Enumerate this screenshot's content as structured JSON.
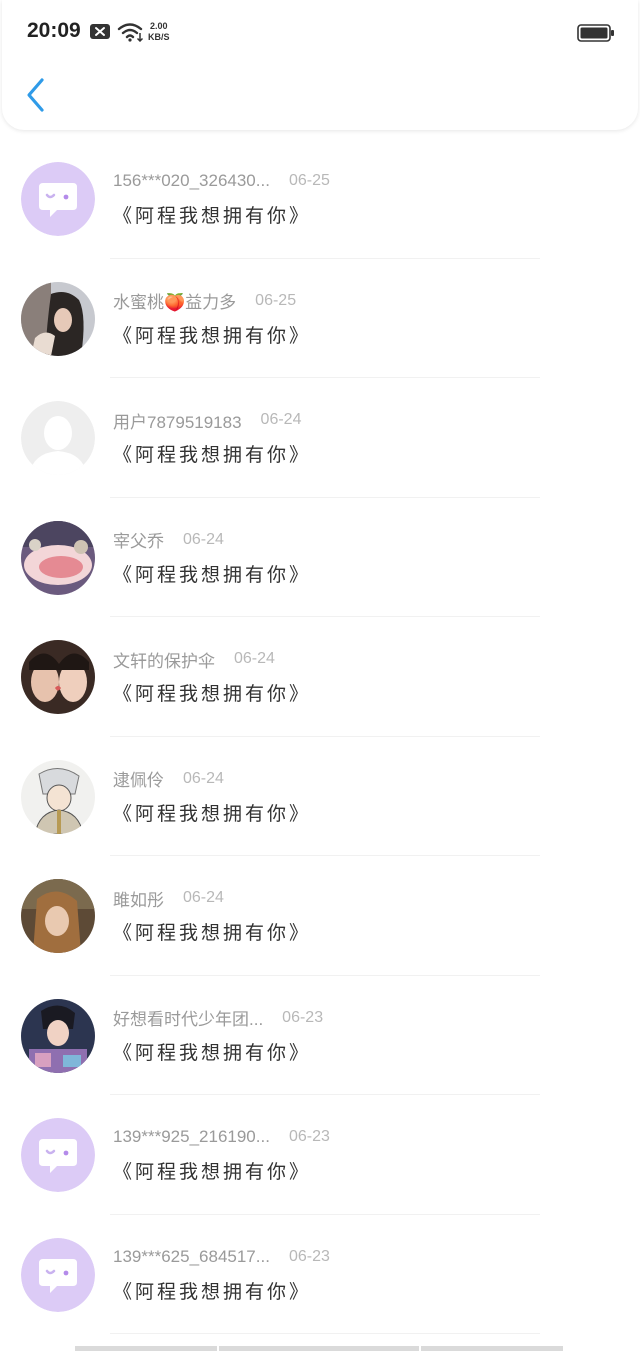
{
  "status_bar": {
    "time": "20:09",
    "network_speed_value": "2.00",
    "network_speed_unit": "KB/S",
    "icons": [
      "notification-icon",
      "wifi-icon",
      "battery-icon"
    ]
  },
  "header": {
    "back_icon": "chevron-left-icon",
    "accent_color": "#2f9be8"
  },
  "list": {
    "items": [
      {
        "name": "156***020_326430...",
        "date": "06-25",
        "message": "《阿程我想拥有你》",
        "avatar": "default-chat-avatar"
      },
      {
        "name": "水蜜桃🍑益力多",
        "date": "06-25",
        "message": "《阿程我想拥有你》",
        "avatar": "photo-avatar"
      },
      {
        "name": "用户7879519183",
        "date": "06-24",
        "message": "《阿程我想拥有你》",
        "avatar": "blank-user-avatar"
      },
      {
        "name": "宰父乔",
        "date": "06-24",
        "message": "《阿程我想拥有你》",
        "avatar": "photo-avatar"
      },
      {
        "name": "文轩的保护伞",
        "date": "06-24",
        "message": "《阿程我想拥有你》",
        "avatar": "photo-avatar"
      },
      {
        "name": "逮佩伶",
        "date": "06-24",
        "message": "《阿程我想拥有你》",
        "avatar": "photo-avatar"
      },
      {
        "name": "雎如彤",
        "date": "06-24",
        "message": "《阿程我想拥有你》",
        "avatar": "photo-avatar"
      },
      {
        "name": "好想看时代少年团...",
        "date": "06-23",
        "message": "《阿程我想拥有你》",
        "avatar": "photo-avatar"
      },
      {
        "name": "139***925_216190...",
        "date": "06-23",
        "message": "《阿程我想拥有你》",
        "avatar": "default-chat-avatar"
      },
      {
        "name": "139***625_684517...",
        "date": "06-23",
        "message": "《阿程我想拥有你》",
        "avatar": "default-chat-avatar"
      }
    ]
  },
  "colors": {
    "default_avatar_bg": "#dccbf6",
    "name_text": "#9a9a9a",
    "date_text": "#b8b8b8",
    "message_text": "#333333"
  }
}
